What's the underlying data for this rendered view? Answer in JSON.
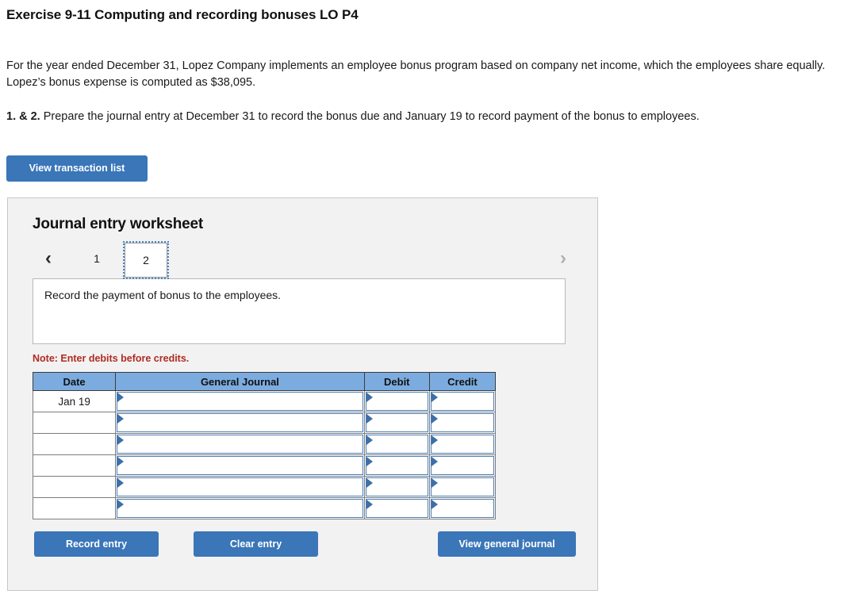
{
  "page": {
    "title": "Exercise 9-11 Computing and recording bonuses LO P4",
    "paragraph_1": "For the year ended December 31, Lopez Company implements an employee bonus program based on company net income, which the employees share equally. Lopez’s bonus expense is computed as $38,095.",
    "paragraph_2_lead": "1. & 2.",
    "paragraph_2_rest": " Prepare the journal entry at December 31 to record the bonus due and January 19 to record payment of the bonus to employees."
  },
  "toolbar": {
    "view_transaction_list_label": "View transaction list"
  },
  "worksheet": {
    "heading": "Journal entry worksheet",
    "pager": {
      "prev_icon": "chevron-left-icon",
      "next_icon": "chevron-right-icon",
      "prev_glyph": "‹",
      "next_glyph": "›",
      "tabs": [
        {
          "label": "1",
          "active": false
        },
        {
          "label": "2",
          "active": true
        }
      ]
    },
    "description": "Record the payment of bonus to the employees.",
    "note": "Note: Enter debits before credits.",
    "table": {
      "columns": [
        "Date",
        "General Journal",
        "Debit",
        "Credit"
      ],
      "rows": [
        {
          "date": "Jan 19",
          "general_journal": "",
          "debit": "",
          "credit": ""
        },
        {
          "date": "",
          "general_journal": "",
          "debit": "",
          "credit": ""
        },
        {
          "date": "",
          "general_journal": "",
          "debit": "",
          "credit": ""
        },
        {
          "date": "",
          "general_journal": "",
          "debit": "",
          "credit": ""
        },
        {
          "date": "",
          "general_journal": "",
          "debit": "",
          "credit": ""
        },
        {
          "date": "",
          "general_journal": "",
          "debit": "",
          "credit": ""
        }
      ]
    },
    "actions": {
      "record_entry_label": "Record entry",
      "clear_entry_label": "Clear entry",
      "view_general_journal_label": "View general journal"
    }
  },
  "colors": {
    "button_blue": "#3a76b8",
    "table_header_blue": "#7cacdf",
    "note_red": "#b02b22",
    "panel_gray": "#f2f2f2",
    "field_border_blue": "#4a7db5"
  }
}
